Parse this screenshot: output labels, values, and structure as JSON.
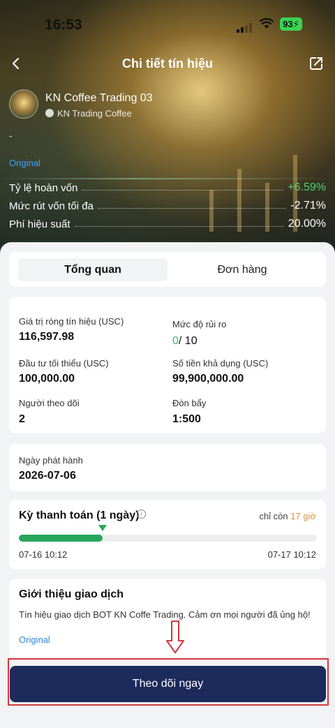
{
  "status_bar": {
    "time": "16:53",
    "battery": "93"
  },
  "nav": {
    "title": "Chi tiết tín hiệu"
  },
  "provider": {
    "name": "KN Coffee Trading 03",
    "owner": "KN Trading Coffee",
    "placeholder": "-",
    "original_link": "Original"
  },
  "stats": [
    {
      "label": "Tỷ lệ hoàn vốn",
      "value": "+6.59%"
    },
    {
      "label": "Mức rút vốn tối đa",
      "value": "-2.71%"
    },
    {
      "label": "Phí hiệu suất",
      "value": "20.00%"
    }
  ],
  "tabs": [
    {
      "label": "Tổng quan"
    },
    {
      "label": "Đơn hàng"
    }
  ],
  "overview": {
    "net_value_label": "Giá trị ròng tín hiệu (USC)",
    "net_value": "116,597.98",
    "risk_label": "Mức độ rủi ro",
    "risk_value": "0",
    "risk_max": "/ 10",
    "min_invest_label": "Đầu tư tối thiểu (USC)",
    "min_invest": "100,000.00",
    "available_label": "Số tiền khả dụng (USC)",
    "available": "99,900,000.00",
    "followers_label": "Người theo dõi",
    "followers": "2",
    "leverage_label": "Đòn bẩy",
    "leverage": "1:500"
  },
  "issue": {
    "label": "Ngày phát hành",
    "date": "2026-07-06"
  },
  "payment": {
    "title": "Kỳ thanh toán (1 ngày)",
    "remaining_prefix": "chỉ còn",
    "remaining_hours": "17 giờ",
    "progress": 0.28,
    "start": "07-16 10:12",
    "end": "07-17 10:12"
  },
  "intro": {
    "title": "Giới thiệu giao dịch",
    "description": "Tín hiệu giao dịch BOT KN Coffe Trading. Cảm ơn mọi người đã ủng hộ!",
    "link": "Original"
  },
  "cta": {
    "label": "Theo dõi ngay"
  },
  "colors": {
    "accent": "#1d2a5c",
    "positive": "#4cd06f",
    "progress": "#27a65b",
    "warning": "#e0923a",
    "highlight": "#d3373d"
  }
}
